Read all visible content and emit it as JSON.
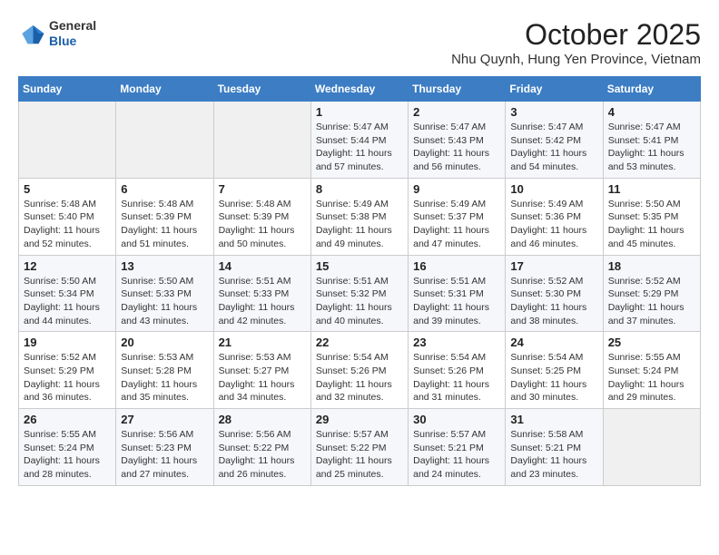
{
  "header": {
    "logo_general": "General",
    "logo_blue": "Blue",
    "month_title": "October 2025",
    "location": "Nhu Quynh, Hung Yen Province, Vietnam"
  },
  "weekdays": [
    "Sunday",
    "Monday",
    "Tuesday",
    "Wednesday",
    "Thursday",
    "Friday",
    "Saturday"
  ],
  "weeks": [
    [
      {
        "day": "",
        "info": ""
      },
      {
        "day": "",
        "info": ""
      },
      {
        "day": "",
        "info": ""
      },
      {
        "day": "1",
        "info": "Sunrise: 5:47 AM\nSunset: 5:44 PM\nDaylight: 11 hours\nand 57 minutes."
      },
      {
        "day": "2",
        "info": "Sunrise: 5:47 AM\nSunset: 5:43 PM\nDaylight: 11 hours\nand 56 minutes."
      },
      {
        "day": "3",
        "info": "Sunrise: 5:47 AM\nSunset: 5:42 PM\nDaylight: 11 hours\nand 54 minutes."
      },
      {
        "day": "4",
        "info": "Sunrise: 5:47 AM\nSunset: 5:41 PM\nDaylight: 11 hours\nand 53 minutes."
      }
    ],
    [
      {
        "day": "5",
        "info": "Sunrise: 5:48 AM\nSunset: 5:40 PM\nDaylight: 11 hours\nand 52 minutes."
      },
      {
        "day": "6",
        "info": "Sunrise: 5:48 AM\nSunset: 5:39 PM\nDaylight: 11 hours\nand 51 minutes."
      },
      {
        "day": "7",
        "info": "Sunrise: 5:48 AM\nSunset: 5:39 PM\nDaylight: 11 hours\nand 50 minutes."
      },
      {
        "day": "8",
        "info": "Sunrise: 5:49 AM\nSunset: 5:38 PM\nDaylight: 11 hours\nand 49 minutes."
      },
      {
        "day": "9",
        "info": "Sunrise: 5:49 AM\nSunset: 5:37 PM\nDaylight: 11 hours\nand 47 minutes."
      },
      {
        "day": "10",
        "info": "Sunrise: 5:49 AM\nSunset: 5:36 PM\nDaylight: 11 hours\nand 46 minutes."
      },
      {
        "day": "11",
        "info": "Sunrise: 5:50 AM\nSunset: 5:35 PM\nDaylight: 11 hours\nand 45 minutes."
      }
    ],
    [
      {
        "day": "12",
        "info": "Sunrise: 5:50 AM\nSunset: 5:34 PM\nDaylight: 11 hours\nand 44 minutes."
      },
      {
        "day": "13",
        "info": "Sunrise: 5:50 AM\nSunset: 5:33 PM\nDaylight: 11 hours\nand 43 minutes."
      },
      {
        "day": "14",
        "info": "Sunrise: 5:51 AM\nSunset: 5:33 PM\nDaylight: 11 hours\nand 42 minutes."
      },
      {
        "day": "15",
        "info": "Sunrise: 5:51 AM\nSunset: 5:32 PM\nDaylight: 11 hours\nand 40 minutes."
      },
      {
        "day": "16",
        "info": "Sunrise: 5:51 AM\nSunset: 5:31 PM\nDaylight: 11 hours\nand 39 minutes."
      },
      {
        "day": "17",
        "info": "Sunrise: 5:52 AM\nSunset: 5:30 PM\nDaylight: 11 hours\nand 38 minutes."
      },
      {
        "day": "18",
        "info": "Sunrise: 5:52 AM\nSunset: 5:29 PM\nDaylight: 11 hours\nand 37 minutes."
      }
    ],
    [
      {
        "day": "19",
        "info": "Sunrise: 5:52 AM\nSunset: 5:29 PM\nDaylight: 11 hours\nand 36 minutes."
      },
      {
        "day": "20",
        "info": "Sunrise: 5:53 AM\nSunset: 5:28 PM\nDaylight: 11 hours\nand 35 minutes."
      },
      {
        "day": "21",
        "info": "Sunrise: 5:53 AM\nSunset: 5:27 PM\nDaylight: 11 hours\nand 34 minutes."
      },
      {
        "day": "22",
        "info": "Sunrise: 5:54 AM\nSunset: 5:26 PM\nDaylight: 11 hours\nand 32 minutes."
      },
      {
        "day": "23",
        "info": "Sunrise: 5:54 AM\nSunset: 5:26 PM\nDaylight: 11 hours\nand 31 minutes."
      },
      {
        "day": "24",
        "info": "Sunrise: 5:54 AM\nSunset: 5:25 PM\nDaylight: 11 hours\nand 30 minutes."
      },
      {
        "day": "25",
        "info": "Sunrise: 5:55 AM\nSunset: 5:24 PM\nDaylight: 11 hours\nand 29 minutes."
      }
    ],
    [
      {
        "day": "26",
        "info": "Sunrise: 5:55 AM\nSunset: 5:24 PM\nDaylight: 11 hours\nand 28 minutes."
      },
      {
        "day": "27",
        "info": "Sunrise: 5:56 AM\nSunset: 5:23 PM\nDaylight: 11 hours\nand 27 minutes."
      },
      {
        "day": "28",
        "info": "Sunrise: 5:56 AM\nSunset: 5:22 PM\nDaylight: 11 hours\nand 26 minutes."
      },
      {
        "day": "29",
        "info": "Sunrise: 5:57 AM\nSunset: 5:22 PM\nDaylight: 11 hours\nand 25 minutes."
      },
      {
        "day": "30",
        "info": "Sunrise: 5:57 AM\nSunset: 5:21 PM\nDaylight: 11 hours\nand 24 minutes."
      },
      {
        "day": "31",
        "info": "Sunrise: 5:58 AM\nSunset: 5:21 PM\nDaylight: 11 hours\nand 23 minutes."
      },
      {
        "day": "",
        "info": ""
      }
    ]
  ]
}
